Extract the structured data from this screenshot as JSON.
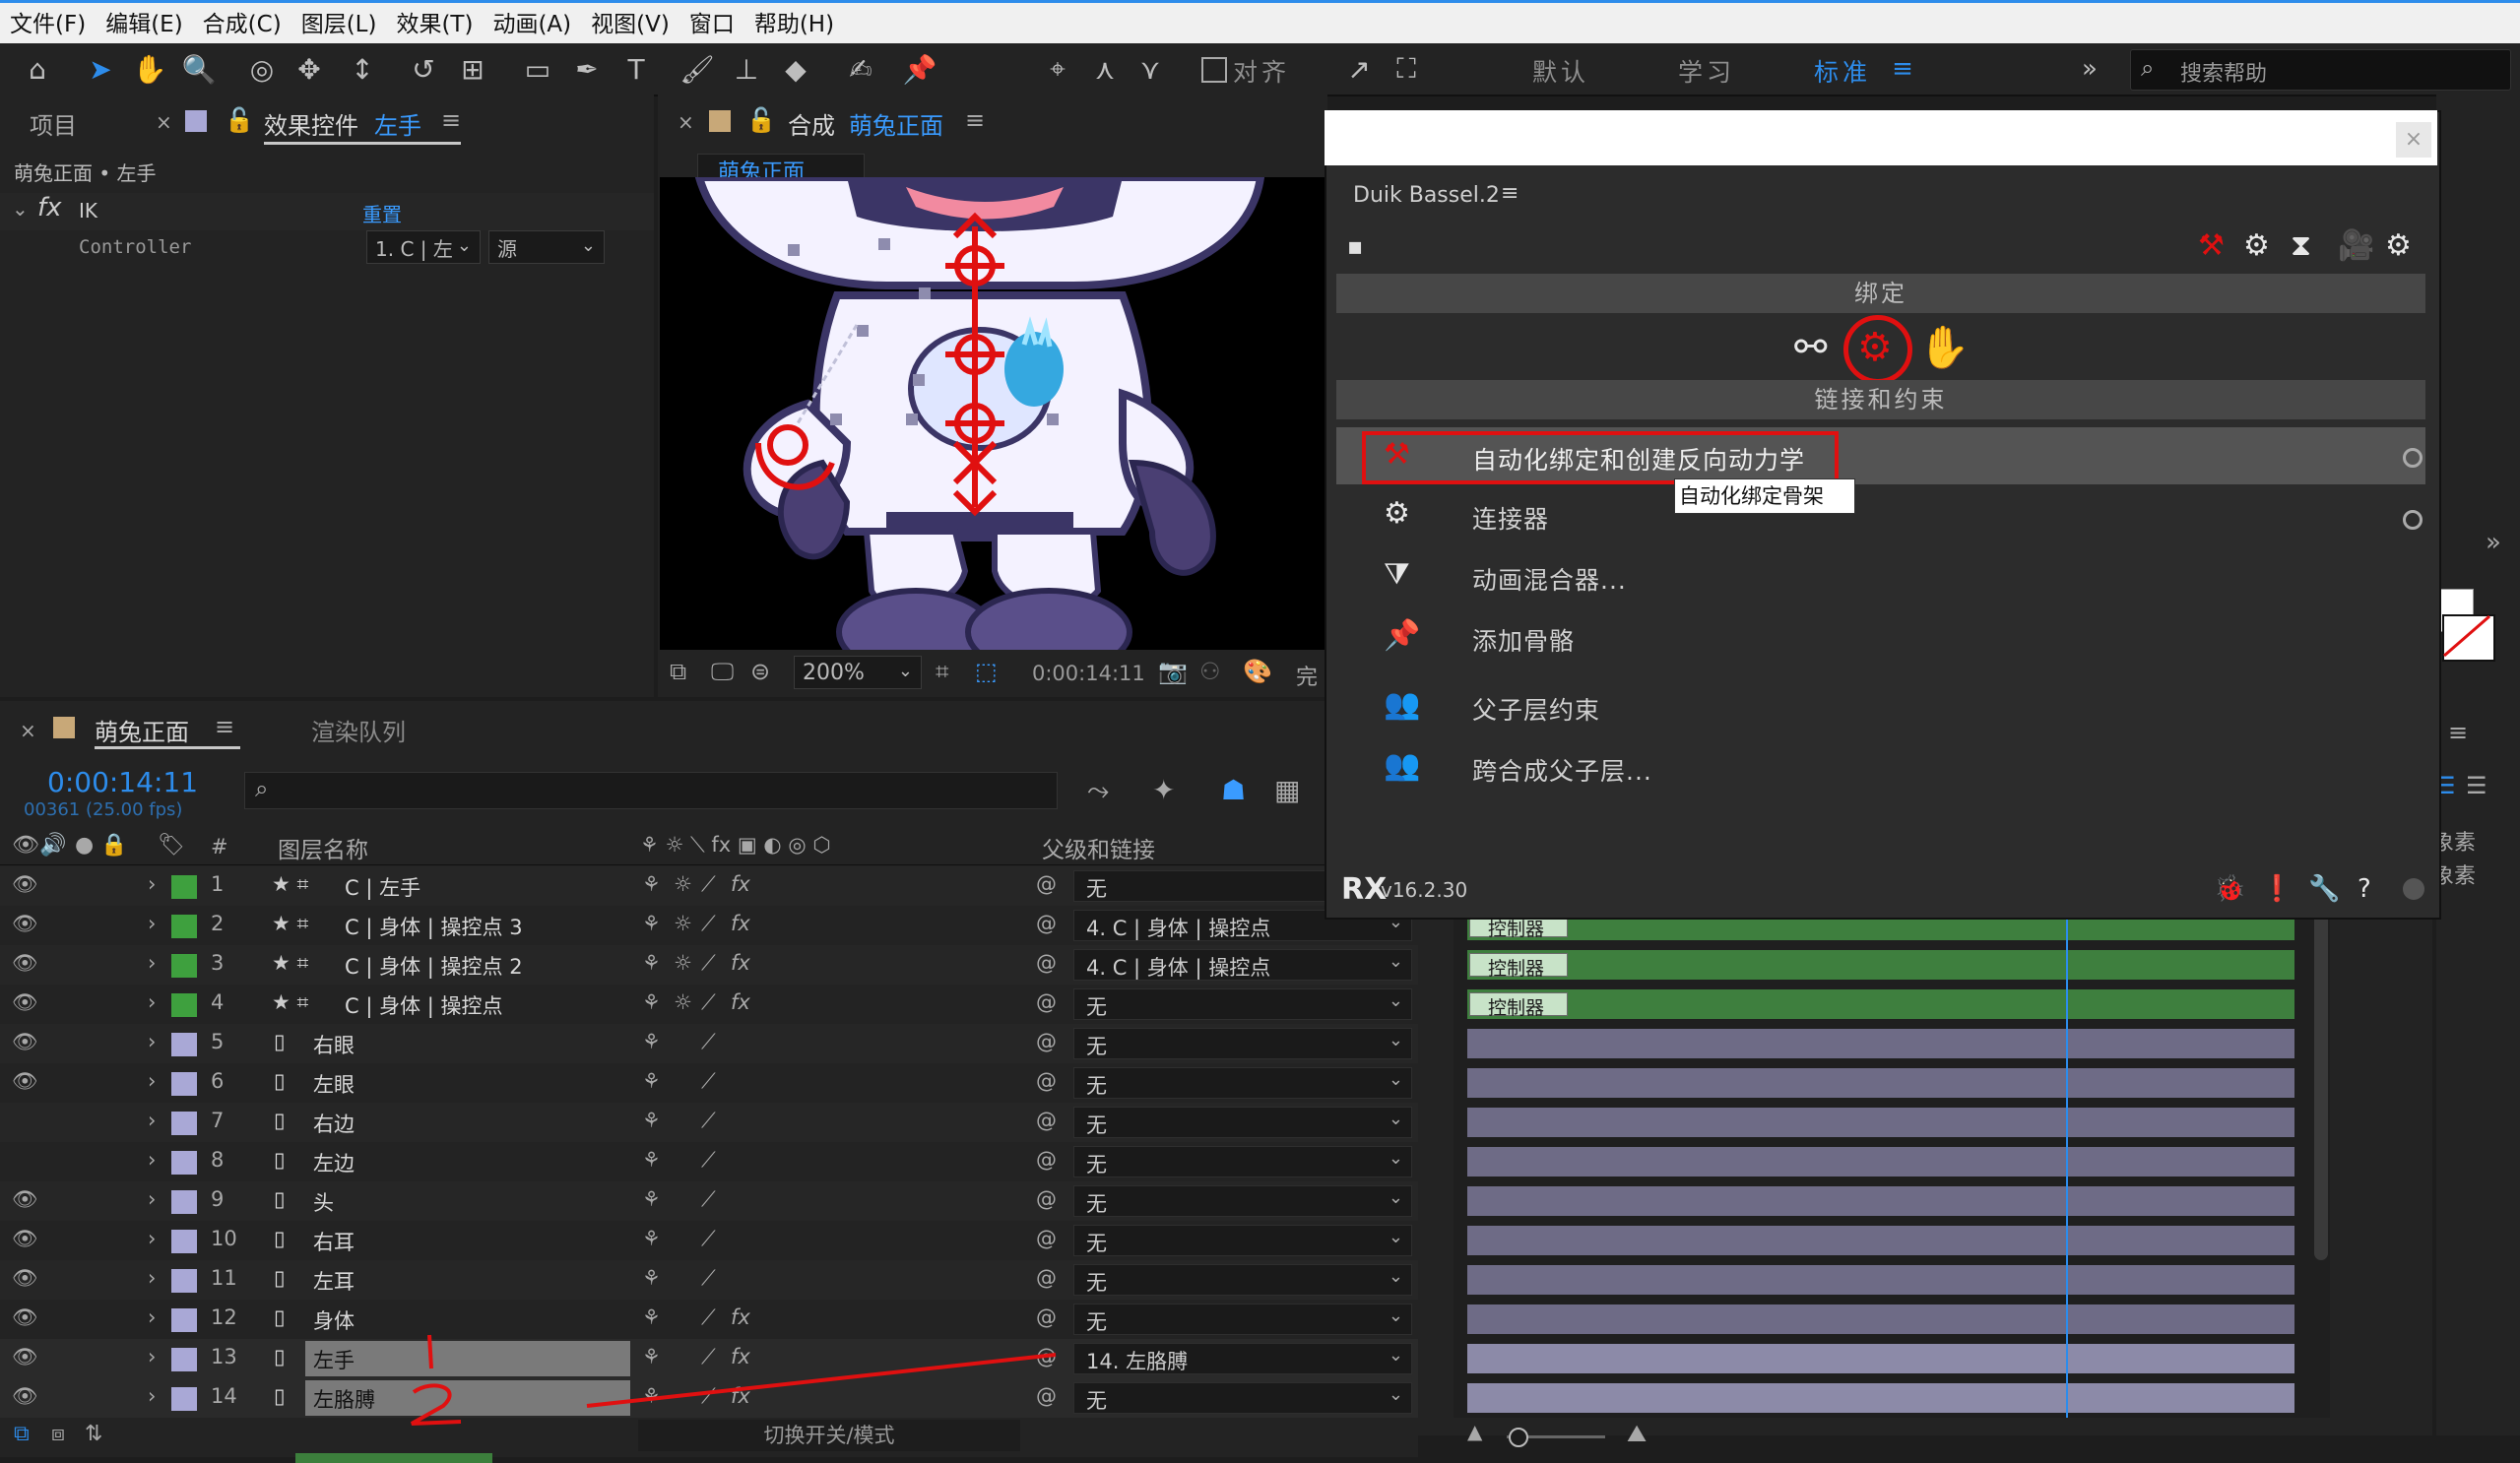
{
  "menubar": [
    "文件(F)",
    "编辑(E)",
    "合成(C)",
    "图层(L)",
    "效果(T)",
    "动画(A)",
    "视图(V)",
    "窗口",
    "帮助(H)"
  ],
  "toolbar": {
    "align_label": "对齐",
    "workspaces": [
      "默认",
      "学习",
      "标准"
    ],
    "active_workspace": "标准",
    "search_placeholder": "搜索帮助"
  },
  "project_panel": {
    "tab_project": "项目",
    "tab_effect_controls": "效果控件",
    "effect_target": "左手",
    "breadcrumb": "萌兔正面 • 左手"
  },
  "effect": {
    "fx_label": "fx",
    "name": "IK",
    "reset": "重置",
    "param_name": "Controller",
    "param_value": "1. C | 左",
    "param_source": "源"
  },
  "composition": {
    "tab_prefix": "合成",
    "comp_name": "萌兔正面",
    "comp_tag": "萌兔正面",
    "zoom": "200%",
    "timecode": "0:00:14:11",
    "quality": "完"
  },
  "timeline": {
    "tab_name": "萌兔正面",
    "tab_render_queue": "渲染队列",
    "timecode": "0:00:14:11",
    "fps": "00361 (25.00 fps)",
    "col_hash": "#",
    "col_name": "图层名称",
    "col_parent": "父级和链接",
    "bottom_label": "切换开关/模式",
    "layers": [
      {
        "num": "1",
        "name": "C | 左手",
        "color": "#3ea03e",
        "shape": true,
        "parent": "无",
        "fx": true
      },
      {
        "num": "2",
        "name": "C | 身体 | 操控点 3",
        "color": "#3ea03e",
        "shape": true,
        "parent": "4. C | 身体 | 操控点",
        "fx": true
      },
      {
        "num": "3",
        "name": "C | 身体 | 操控点 2",
        "color": "#3ea03e",
        "shape": true,
        "parent": "4. C | 身体 | 操控点",
        "fx": true
      },
      {
        "num": "4",
        "name": "C | 身体 | 操控点",
        "color": "#3ea03e",
        "shape": true,
        "parent": "无",
        "fx": true
      },
      {
        "num": "5",
        "name": "右眼",
        "color": "#a9a8d6",
        "shape": false,
        "parent": "无",
        "fx": false
      },
      {
        "num": "6",
        "name": "左眼",
        "color": "#a9a8d6",
        "shape": false,
        "parent": "无",
        "fx": false
      },
      {
        "num": "7",
        "name": "右边",
        "color": "#a9a8d6",
        "shape": false,
        "parent": "无",
        "fx": false
      },
      {
        "num": "8",
        "name": "左边",
        "color": "#a9a8d6",
        "shape": false,
        "parent": "无",
        "fx": false
      },
      {
        "num": "9",
        "name": "头",
        "color": "#a9a8d6",
        "shape": false,
        "parent": "无",
        "fx": false
      },
      {
        "num": "10",
        "name": "右耳",
        "color": "#a9a8d6",
        "shape": false,
        "parent": "无",
        "fx": false
      },
      {
        "num": "11",
        "name": "左耳",
        "color": "#a9a8d6",
        "shape": false,
        "parent": "无",
        "fx": false
      },
      {
        "num": "12",
        "name": "身体",
        "color": "#a9a8d6",
        "shape": false,
        "parent": "无",
        "fx": true
      },
      {
        "num": "13",
        "name": "左手",
        "color": "#a9a8d6",
        "shape": false,
        "parent": "14. 左胳膊",
        "fx": true
      },
      {
        "num": "14",
        "name": "左胳膊",
        "color": "#a9a8d6",
        "shape": false,
        "parent": "无",
        "fx": true
      }
    ],
    "controller_tag": "控制器"
  },
  "duik": {
    "title": "Duik Bassel.2",
    "section_rig": "绑定",
    "section_links": "链接和约束",
    "items": [
      "自动化绑定和创建反向动力学",
      "连接器",
      "动画混合器...",
      "添加骨骼",
      "父子层约束",
      "跨合成父子层..."
    ],
    "tooltip": "自动化绑定骨架",
    "version": "v16.2.30"
  },
  "right_panel": {
    "unit_1": "象素",
    "unit_2": "象素"
  },
  "annotations": {
    "mark_1": "1",
    "mark_2": "2"
  }
}
